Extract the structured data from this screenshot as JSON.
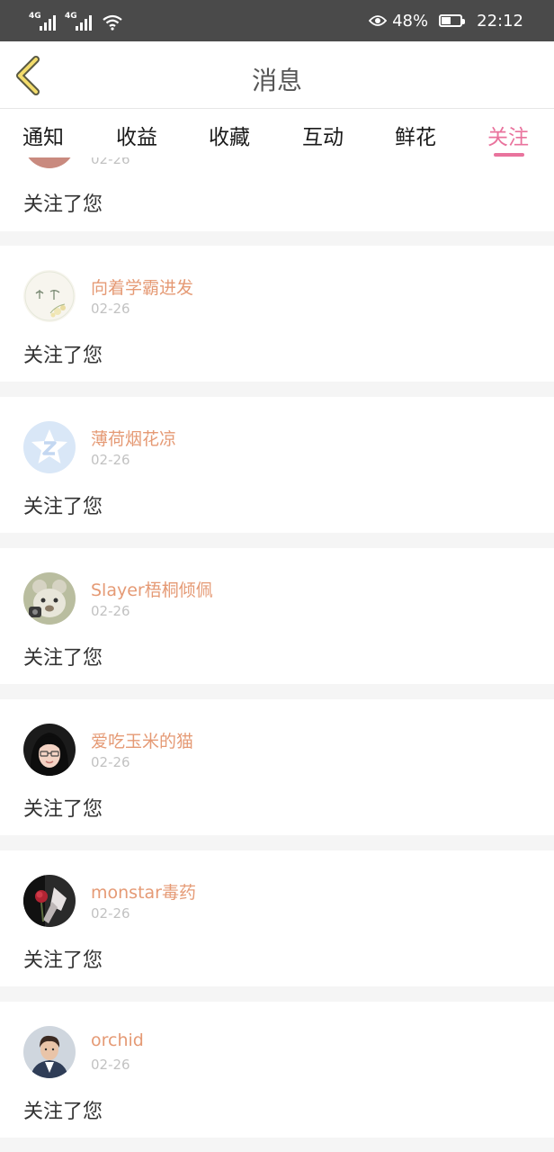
{
  "status_bar": {
    "signal_1_label": "4G",
    "signal_2_label": "4G",
    "wifi_icon": "wifi-icon",
    "eye_icon": "eye-comfort-icon",
    "battery_percent": "48%",
    "battery_level": 0.48,
    "time": "22:12"
  },
  "header": {
    "back_icon": "chevron-left-icon",
    "title": "消息"
  },
  "tabs": [
    {
      "label": "通知",
      "active": false
    },
    {
      "label": "收益",
      "active": false
    },
    {
      "label": "收藏",
      "active": false
    },
    {
      "label": "互动",
      "active": false
    },
    {
      "label": "鲜花",
      "active": false
    },
    {
      "label": "关注",
      "active": true
    }
  ],
  "colors": {
    "accent": "#e9739d",
    "username": "#e59a75",
    "date": "#c2c2c2",
    "status_bar_bg": "#4a4a4a",
    "page_bg": "#f5f5f5"
  },
  "partial_item": {
    "date": "02-26",
    "message": "关注了您"
  },
  "items": [
    {
      "name": "向着学霸进发",
      "date": "02-26",
      "message": "关注了您",
      "avatar": "floral-text-avatar"
    },
    {
      "name": "薄荷烟花凉",
      "date": "02-26",
      "message": "关注了您",
      "avatar": "default-q-avatar"
    },
    {
      "name": "Slayer梧桐倾佩",
      "date": "02-26",
      "message": "关注了您",
      "avatar": "plush-toy-avatar"
    },
    {
      "name": "爱吃玉米的猫",
      "date": "02-26",
      "message": "关注了您",
      "avatar": "cartoon-girl-avatar"
    },
    {
      "name": "monstar毒药",
      "date": "02-26",
      "message": "关注了您",
      "avatar": "rose-avatar"
    },
    {
      "name": "orchid",
      "date": "02-26",
      "message": "关注了您",
      "avatar": "man-portrait-avatar"
    }
  ]
}
